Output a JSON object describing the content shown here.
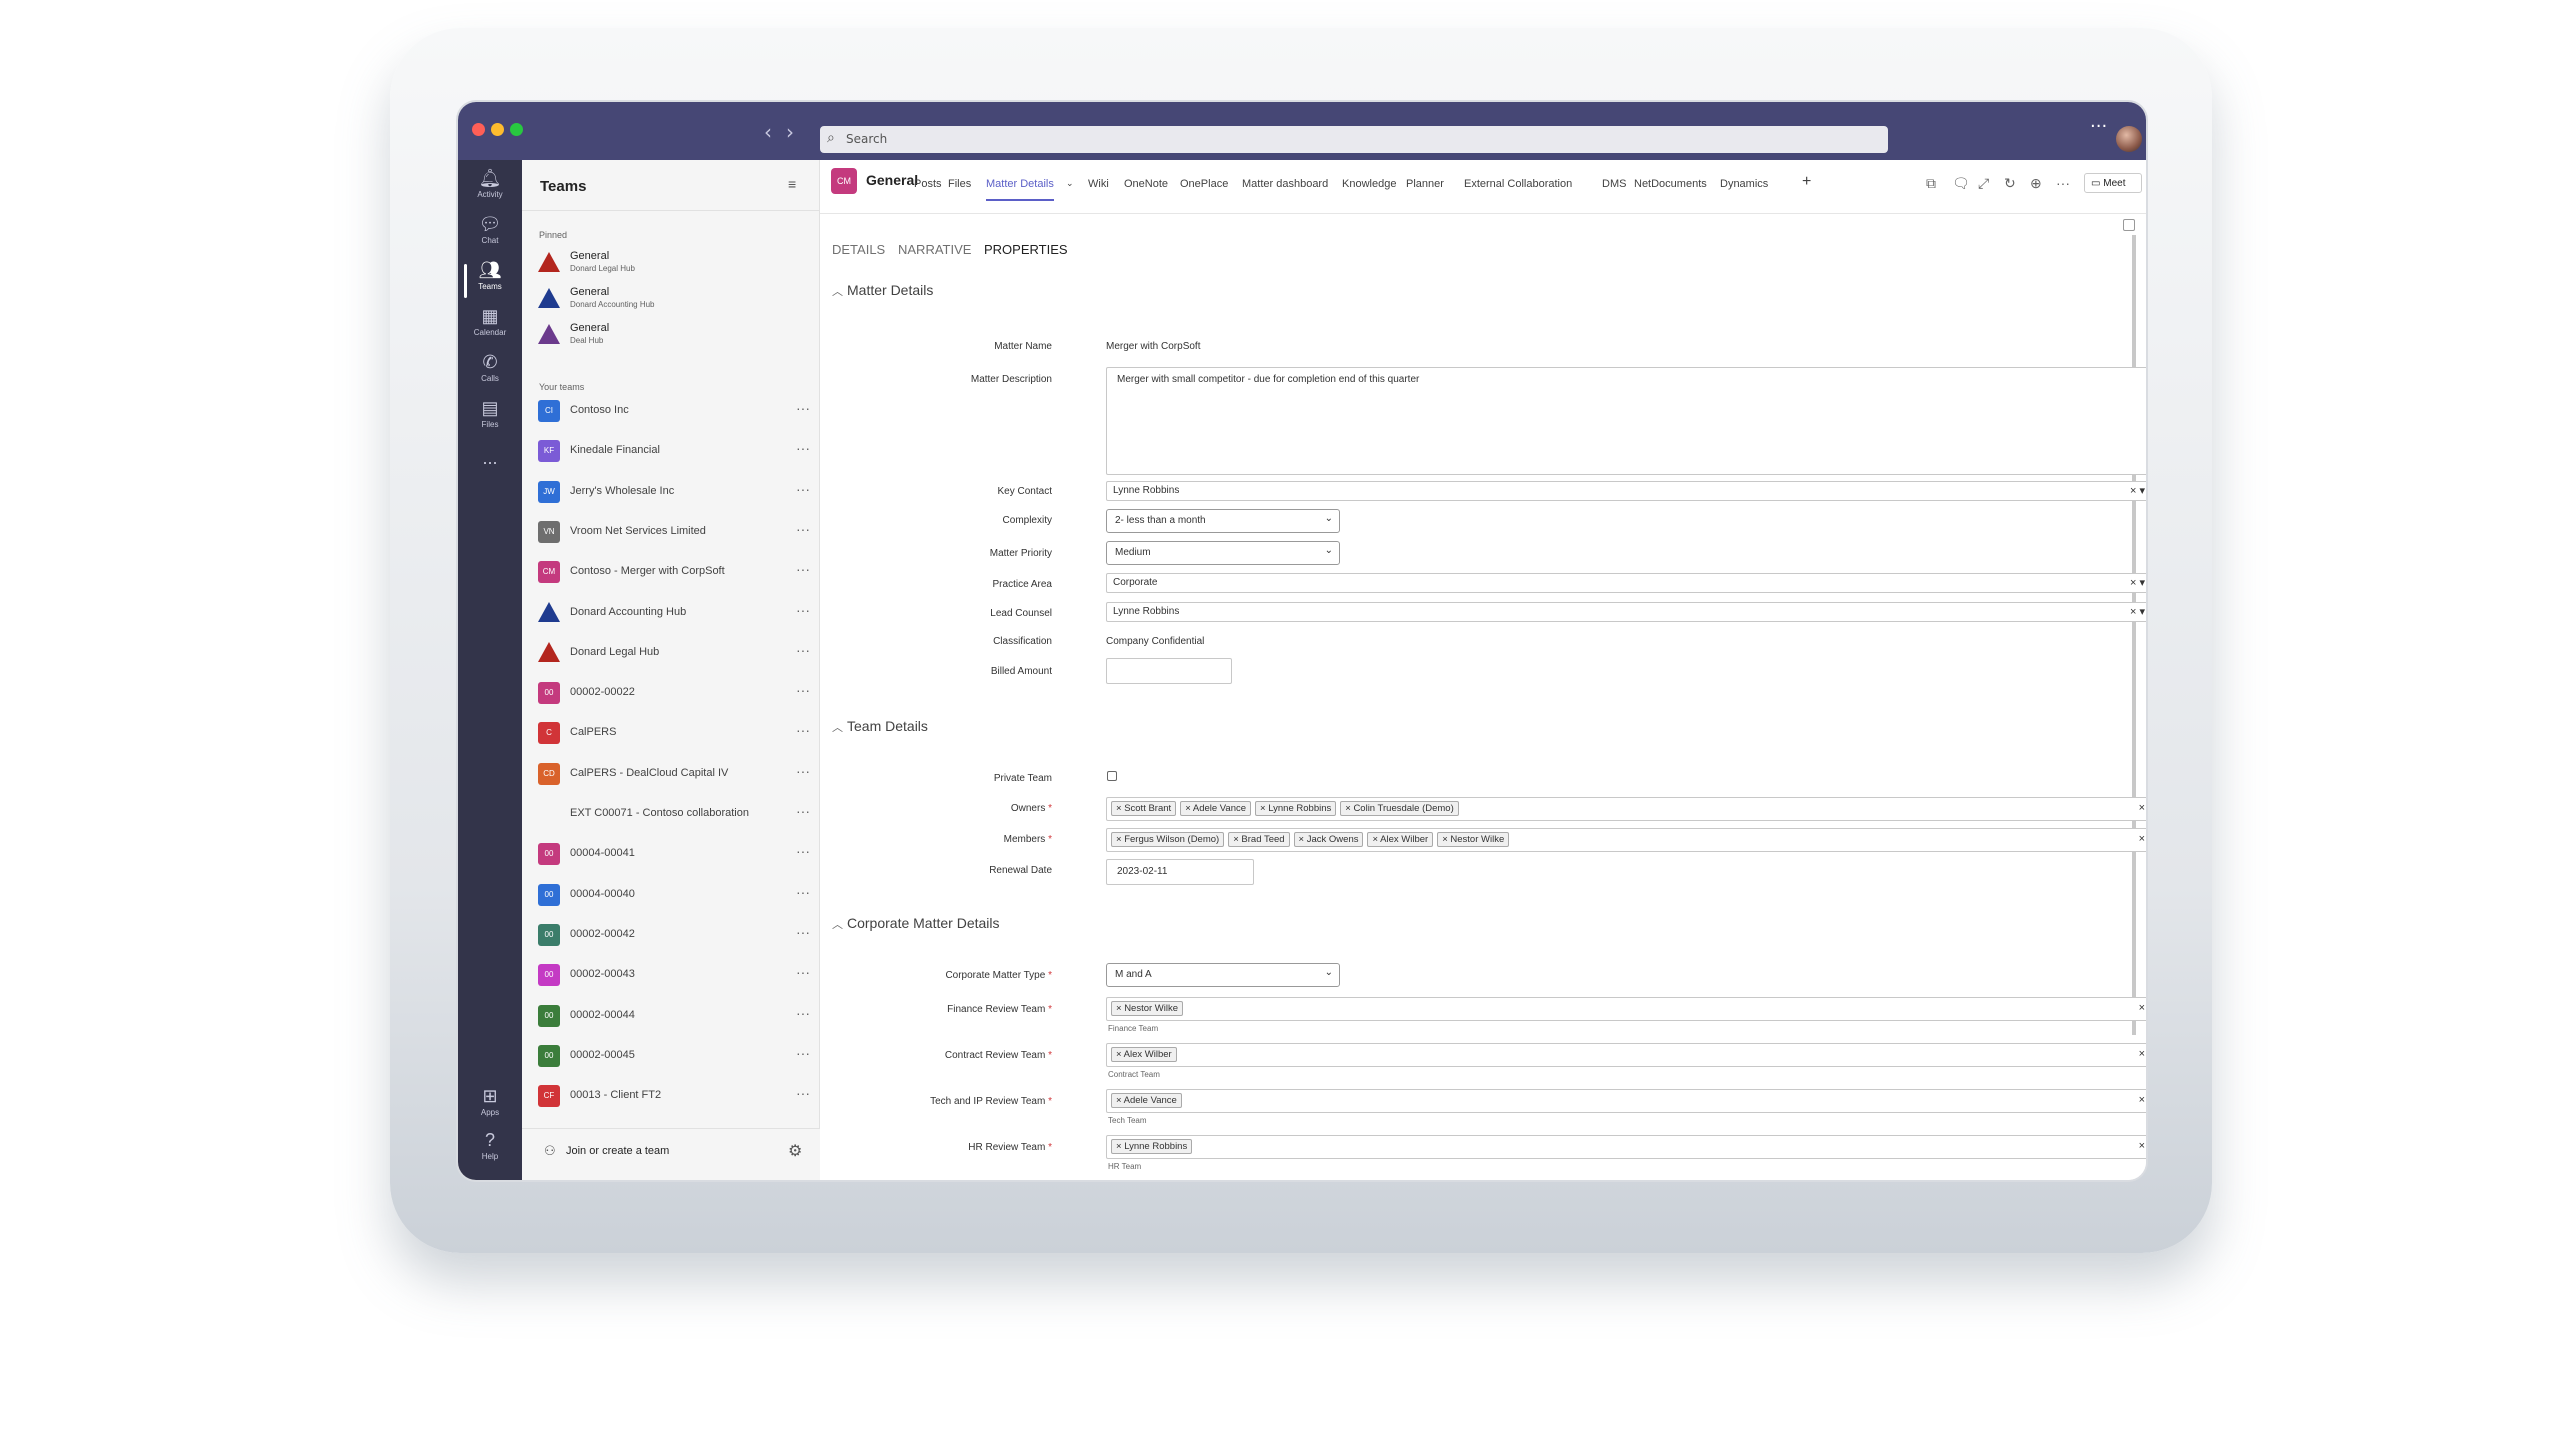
{
  "search": {
    "placeholder": "Search"
  },
  "rail": [
    {
      "label": "Activity",
      "icon": "bell-icon"
    },
    {
      "label": "Chat",
      "icon": "chat-icon"
    },
    {
      "label": "Teams",
      "icon": "teams-icon"
    },
    {
      "label": "Calendar",
      "icon": "calendar-icon"
    },
    {
      "label": "Calls",
      "icon": "phone-icon"
    },
    {
      "label": "Files",
      "icon": "file-icon"
    },
    {
      "label": "...",
      "icon": "more-icon"
    },
    {
      "label": "Apps",
      "icon": "apps-icon"
    },
    {
      "label": "Help",
      "icon": "help-icon"
    }
  ],
  "sidebar": {
    "title": "Teams",
    "pinned_label": "Pinned",
    "your_teams_label": "Your teams",
    "pinned": [
      {
        "name": "General",
        "sub": "Donard Legal Hub",
        "color": "#b3261e"
      },
      {
        "name": "General",
        "sub": "Donard Accounting Hub",
        "color": "#1f3b8f"
      },
      {
        "name": "General",
        "sub": "Deal Hub",
        "color": "#6b3a8c"
      }
    ],
    "teams": [
      {
        "name": "Contoso Inc",
        "abbr": "CI",
        "color": "#2f6fd6"
      },
      {
        "name": "Kinedale Financial",
        "abbr": "KF",
        "color": "#7b5bd6"
      },
      {
        "name": "Jerry's Wholesale Inc",
        "abbr": "JW",
        "color": "#2f6fd6"
      },
      {
        "name": "Vroom Net Services Limited",
        "abbr": "VN",
        "color": "#6e6e6e"
      },
      {
        "name": "Contoso - Merger with CorpSoft",
        "abbr": "CM",
        "color": "#c43a7e"
      },
      {
        "name": "Donard Accounting Hub",
        "abbr": "",
        "color": "#1f3b8f"
      },
      {
        "name": "Donard Legal Hub",
        "abbr": "",
        "color": "#b3261e"
      },
      {
        "name": "00002-00022",
        "abbr": "00",
        "color": "#c43a7e"
      },
      {
        "name": "CalPERS",
        "abbr": "C",
        "color": "#d13438"
      },
      {
        "name": "CalPERS - DealCloud Capital IV",
        "abbr": "CD",
        "color": "#d9622b"
      },
      {
        "name": "EXT C00071 - Contoso collaboration",
        "abbr": "",
        "color": "#f5f5f5"
      },
      {
        "name": "00004-00041",
        "abbr": "00",
        "color": "#c43a7e"
      },
      {
        "name": "00004-00040",
        "abbr": "00",
        "color": "#2f6fd6"
      },
      {
        "name": "00002-00042",
        "abbr": "00",
        "color": "#3b7d6a"
      },
      {
        "name": "00002-00043",
        "abbr": "00",
        "color": "#c43ac4"
      },
      {
        "name": "00002-00044",
        "abbr": "00",
        "color": "#3b7d3b"
      },
      {
        "name": "00002-00045",
        "abbr": "00",
        "color": "#3b7d3b"
      },
      {
        "name": "00013 - Client FT2",
        "abbr": "CF",
        "color": "#d13438"
      }
    ],
    "join_label": "Join or create a team"
  },
  "channel": {
    "avatar": "CM",
    "name": "General",
    "tabs": [
      "Posts",
      "Files",
      "Matter Details",
      "Wiki",
      "OneNote",
      "OnePlace",
      "Matter dashboard",
      "Knowledge",
      "Planner",
      "External Collaboration",
      "DMS",
      "NetDocuments",
      "Dynamics"
    ],
    "active_tab": "Matter Details",
    "meet_label": "Meet"
  },
  "page_tabs": [
    "DETAILS",
    "NARRATIVE",
    "PROPERTIES"
  ],
  "active_page_tab": "PROPERTIES",
  "sections": {
    "matter": "Matter Details",
    "team": "Team Details",
    "corporate": "Corporate Matter Details"
  },
  "form": {
    "matter_name_label": "Matter Name",
    "matter_name": "Merger with CorpSoft",
    "matter_description_label": "Matter Description",
    "matter_description": "Merger with small competitor - due for completion end of this quarter",
    "key_contact_label": "Key Contact",
    "key_contact": "Lynne Robbins",
    "complexity_label": "Complexity",
    "complexity": "2- less than a month",
    "matter_priority_label": "Matter Priority",
    "matter_priority": "Medium",
    "practice_area_label": "Practice Area",
    "practice_area": "Corporate",
    "lead_counsel_label": "Lead Counsel",
    "lead_counsel": "Lynne Robbins",
    "classification_label": "Classification",
    "classification": "Company Confidential",
    "billed_amount_label": "Billed Amount",
    "billed_amount": "",
    "private_team_label": "Private Team",
    "private_team": false,
    "owners_label": "Owners",
    "owners": [
      "Scott Brant",
      "Adele Vance",
      "Lynne Robbins",
      "Colin Truesdale (Demo)"
    ],
    "members_label": "Members",
    "members": [
      "Fergus Wilson (Demo)",
      "Brad Teed",
      "Jack Owens",
      "Alex Wilber",
      "Nestor Wilke"
    ],
    "renewal_date_label": "Renewal Date",
    "renewal_date": "2023-02-11",
    "corporate_matter_type_label": "Corporate Matter Type",
    "corporate_matter_type": "M and A",
    "finance_review_label": "Finance Review Team",
    "finance_review": [
      "Nestor Wilke"
    ],
    "finance_hint": "Finance Team",
    "contract_review_label": "Contract Review Team",
    "contract_review": [
      "Alex Wilber"
    ],
    "contract_hint": "Contract Team",
    "tech_review_label": "Tech and IP Review Team",
    "tech_review": [
      "Adele Vance"
    ],
    "tech_hint": "Tech Team",
    "hr_review_label": "HR Review Team",
    "hr_review": [
      "Lynne Robbins"
    ],
    "hr_hint": "HR Team"
  }
}
